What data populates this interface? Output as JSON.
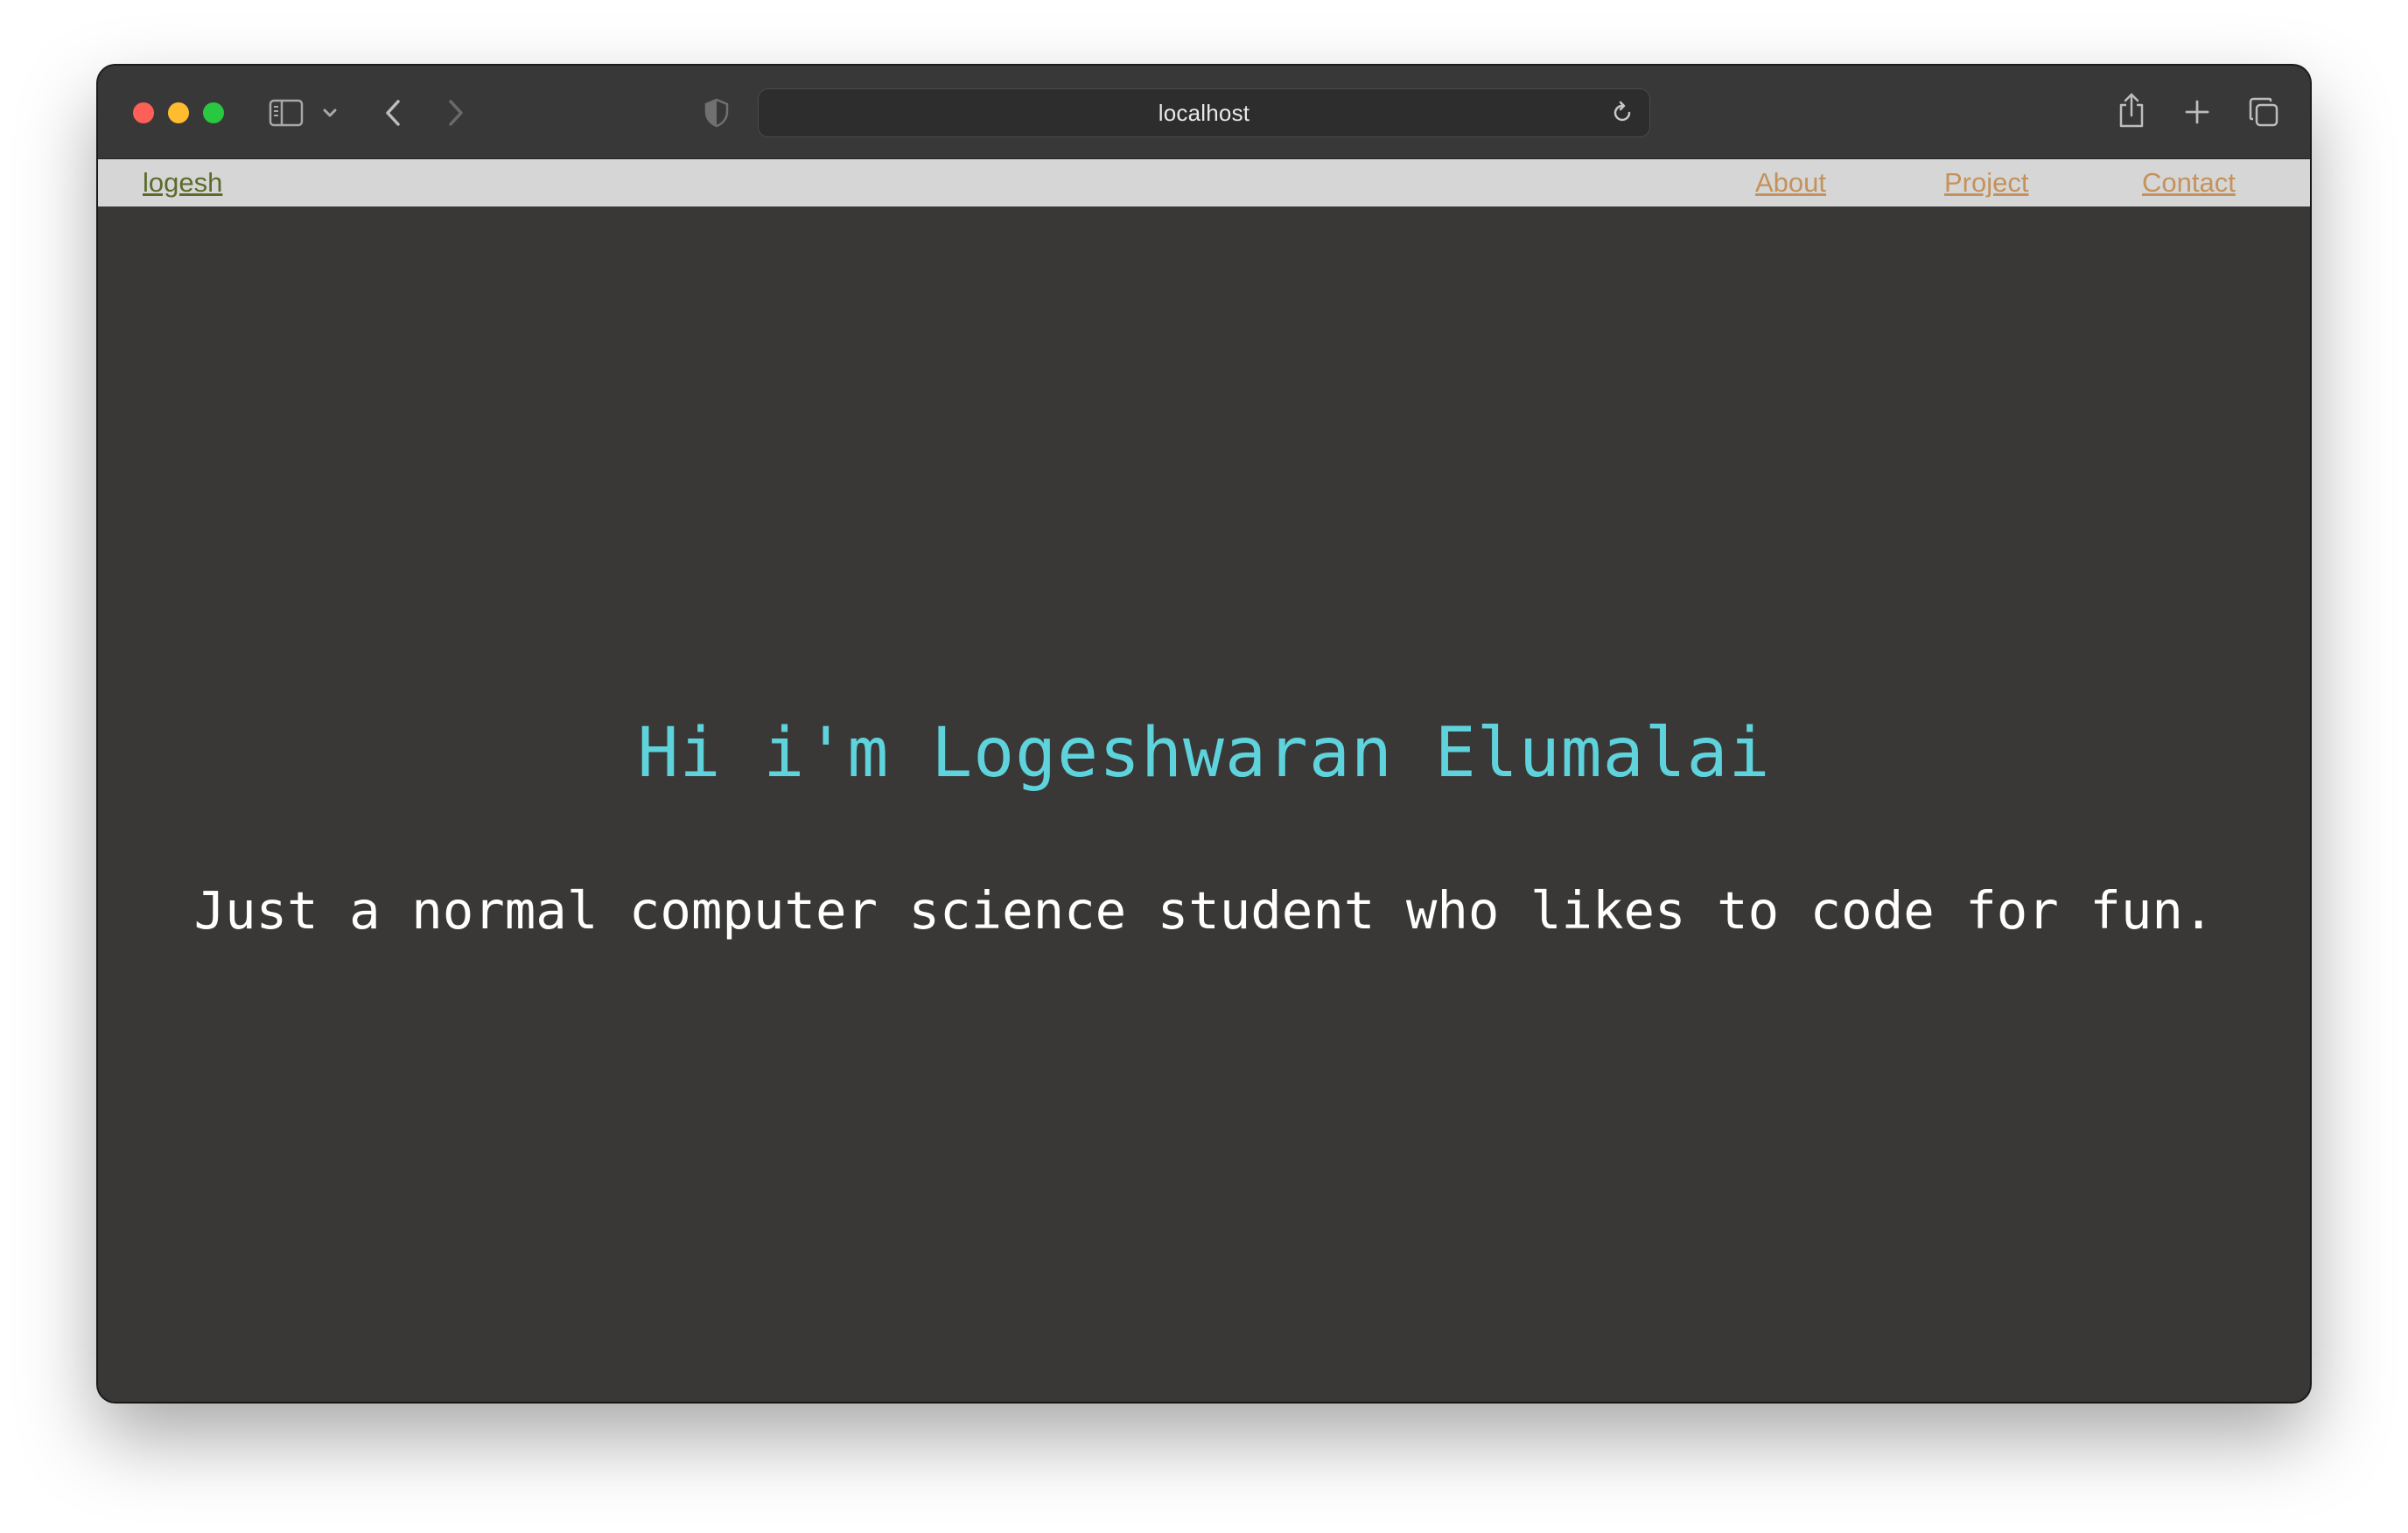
{
  "browser": {
    "url": "localhost",
    "icons": {
      "sidebar": "sidebar-icon",
      "sidebar_menu": "chevron-down-icon",
      "back": "back-arrow-icon",
      "forward": "forward-arrow-icon",
      "privacy": "shield-icon",
      "reload": "reload-icon",
      "share": "share-icon",
      "new_tab": "plus-icon",
      "tabs": "tab-overview-icon"
    }
  },
  "page": {
    "nav": {
      "brand": "logesh",
      "links": [
        "About",
        "Project",
        "Contact"
      ]
    },
    "hero": {
      "title": "Hi i'm Logeshwaran Elumalai",
      "subtitle": "Just a normal computer science student who likes to code for fun."
    },
    "colors": {
      "background": "#393837",
      "navbar": "#d6d6d6",
      "brand": "#5b6b2a",
      "nav_link": "#c4925a",
      "title": "#5fd3dc",
      "subtitle": "#ffffff"
    }
  }
}
